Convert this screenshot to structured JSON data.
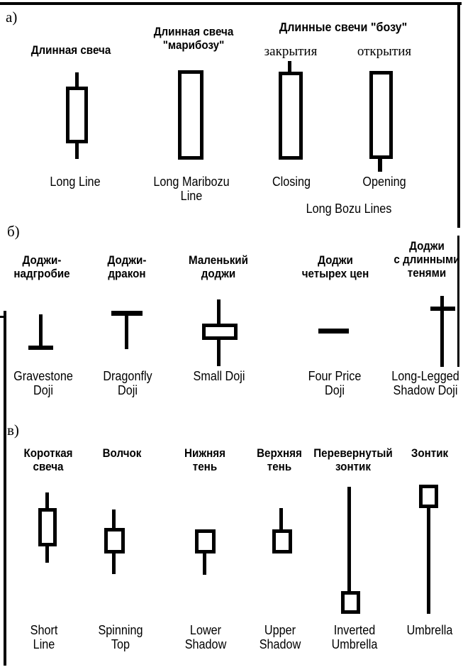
{
  "figure": {
    "type": "candlestick-glossary-diagram",
    "language_primary": "ru",
    "language_secondary": "en",
    "ink_color": "#000000",
    "background_color": "#ffffff"
  },
  "sections": [
    {
      "letter": "а)",
      "group_heading_ru": "Длинные свечи \"бозу\"",
      "group_caption_en": "Long Bozu Lines",
      "items": [
        {
          "label_ru": "Длинная свеча",
          "label_en": "Long Line",
          "shape": "long-line-candle",
          "has_upper_wick": true,
          "has_lower_wick": true,
          "body": "large-hollow"
        },
        {
          "label_ru": "Длинная свеча\n\"марибозу\"",
          "label_en": "Long Maribozu\nLine",
          "shape": "long-marubozu-candle",
          "has_upper_wick": false,
          "has_lower_wick": false,
          "body": "tall-hollow"
        },
        {
          "label_ru": "закрытия",
          "label_en": "Closing",
          "shape": "closing-bozu-candle",
          "has_upper_wick": true,
          "has_lower_wick": false,
          "body": "tall-hollow"
        },
        {
          "label_ru": "открытия",
          "label_en": "Opening",
          "shape": "opening-bozu-candle",
          "has_upper_wick": false,
          "has_lower_wick": true,
          "body": "tall-hollow"
        }
      ]
    },
    {
      "letter": "б)",
      "items": [
        {
          "label_ru": "Доджи-\nнадгробие",
          "label_en": "Gravestone\nDoji",
          "shape": "gravestone-doji",
          "has_upper_wick": true,
          "has_lower_wick": false,
          "body": "flat-line-bottom"
        },
        {
          "label_ru": "Доджи-\nдракон",
          "label_en": "Dragonfly\nDoji",
          "shape": "dragonfly-doji",
          "has_upper_wick": false,
          "has_lower_wick": true,
          "body": "flat-line-top"
        },
        {
          "label_ru": "Маленький\nдоджи",
          "label_en": "Small Doji",
          "shape": "small-doji",
          "has_upper_wick": true,
          "has_lower_wick": true,
          "body": "small-hollow"
        },
        {
          "label_ru": "Доджи\nчетырех цен",
          "label_en": "Four Price\nDoji",
          "shape": "four-price-doji",
          "has_upper_wick": false,
          "has_lower_wick": false,
          "body": "flat-line-only"
        },
        {
          "label_ru": "Доджи\nс длинными\nтенями",
          "label_en": "Long-Legged\nShadow Doji",
          "shape": "long-legged-doji",
          "has_upper_wick": true,
          "has_lower_wick": true,
          "body": "flat-line-middle"
        }
      ]
    },
    {
      "letter": "в)",
      "items": [
        {
          "label_ru": "Короткая\nсвеча",
          "label_en": "Short\nLine",
          "shape": "short-line-candle",
          "has_upper_wick": true,
          "has_lower_wick": true,
          "body": "medium-hollow"
        },
        {
          "label_ru": "Волчок",
          "label_en": "Spinning\nTop",
          "shape": "spinning-top-candle",
          "has_upper_wick": true,
          "has_lower_wick": true,
          "body": "small-hollow"
        },
        {
          "label_ru": "Нижняя\nтень",
          "label_en": "Lower\nShadow",
          "shape": "lower-shadow-candle",
          "has_upper_wick": false,
          "has_lower_wick": true,
          "body": "small-hollow"
        },
        {
          "label_ru": "Верхняя\nтень",
          "label_en": "Upper\nShadow",
          "shape": "upper-shadow-candle",
          "has_upper_wick": true,
          "has_lower_wick": false,
          "body": "small-hollow"
        },
        {
          "label_ru": "Перевернутый\nзонтик",
          "label_en": "Inverted\nUmbrella",
          "shape": "inverted-umbrella-candle",
          "has_upper_wick": true,
          "has_lower_wick": false,
          "body": "small-hollow-bottom"
        },
        {
          "label_ru": "Зонтик",
          "label_en": "Umbrella",
          "shape": "umbrella-candle",
          "has_upper_wick": false,
          "has_lower_wick": true,
          "body": "small-hollow-top"
        }
      ]
    }
  ]
}
